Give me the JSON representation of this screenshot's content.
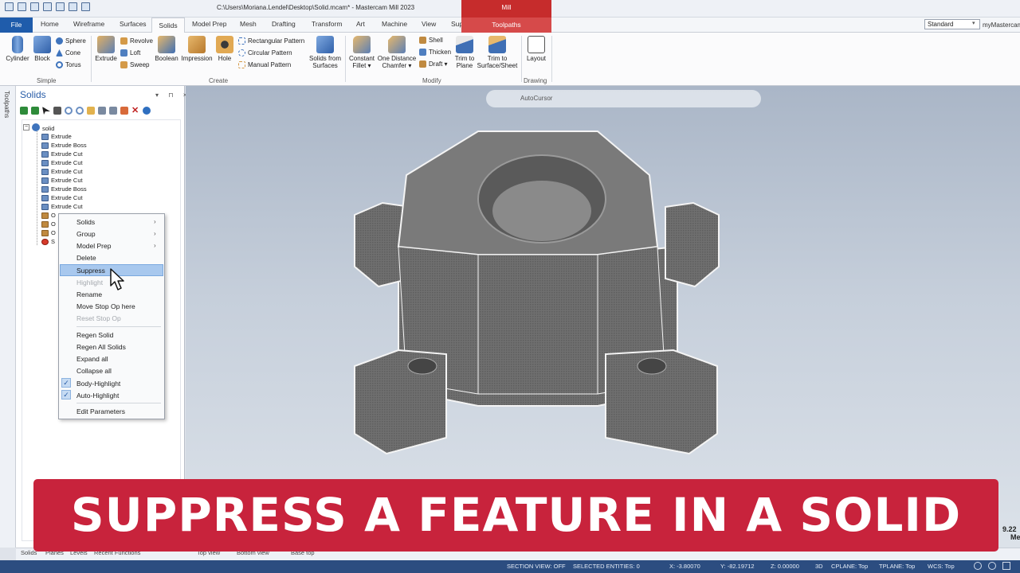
{
  "window": {
    "title": "C:\\Users\\Moriana.Lendel\\Desktop\\Solid.mcam* - Mastercam Mill 2023",
    "context_tab_group": "Mill"
  },
  "tabs": [
    "File",
    "Home",
    "Wireframe",
    "Surfaces",
    "Solids",
    "Model Prep",
    "Mesh",
    "Drafting",
    "Transform",
    "Art",
    "Machine",
    "View",
    "Support",
    "Toolpaths"
  ],
  "active_tab": "Solids",
  "view_select": "Standard",
  "my_mastercam": "myMastercam",
  "ribbon": {
    "groups": [
      "Simple",
      "Create",
      "Modify",
      "Drawing"
    ],
    "simple": {
      "cylinder": "Cylinder",
      "block": "Block",
      "sphere": "Sphere",
      "cone": "Cone",
      "torus": "Torus"
    },
    "create": {
      "extrude": "Extrude",
      "revolve": "Revolve",
      "loft": "Loft",
      "sweep": "Sweep",
      "boolean": "Boolean",
      "impression": "Impression",
      "hole": "Hole",
      "rect_pattern": "Rectangular Pattern",
      "circ_pattern": "Circular Pattern",
      "manual_pattern": "Manual Pattern",
      "solids_from_1": "Solids from",
      "solids_from_2": "Surfaces"
    },
    "modify": {
      "const_fillet_1": "Constant",
      "const_fillet_2": "Fillet ▾",
      "one_dist_1": "One Distance",
      "one_dist_2": "Chamfer ▾",
      "shell": "Shell",
      "thicken": "Thicken",
      "draft": "Draft ▾",
      "trim_plane_1": "Trim to",
      "trim_plane_2": "Plane",
      "trim_surf_1": "Trim to",
      "trim_surf_2": "Surface/Sheet"
    },
    "drawing": {
      "layout": "Layout"
    }
  },
  "dock_label": "Toolpaths",
  "panel": {
    "title": "Solids",
    "controls": "▾ ⊓ ×",
    "root": "solid",
    "items": [
      "Extrude",
      "Extrude Boss",
      "Extrude Cut",
      "Extrude Cut",
      "Extrude Cut",
      "Extrude Cut",
      "Extrude Boss",
      "Extrude Cut",
      "Extrude Cut"
    ],
    "partial_items": [
      "O",
      "O",
      "O",
      "S"
    ]
  },
  "context_menu": {
    "items": [
      {
        "label": "Solids",
        "submenu": true,
        "disabled": false
      },
      {
        "label": "Group",
        "submenu": true,
        "disabled": false
      },
      {
        "label": "Model Prep",
        "submenu": true,
        "disabled": false
      },
      {
        "label": "Delete",
        "disabled": false
      },
      {
        "label": "Suppress",
        "disabled": false,
        "highlighted": true
      },
      {
        "label": "Highlight",
        "disabled": true
      },
      {
        "label": "Rename",
        "disabled": false
      },
      {
        "label": "Move Stop Op here",
        "disabled": false
      },
      {
        "label": "Reset Stop Op",
        "disabled": true
      },
      {
        "label": "Regen Solid",
        "disabled": false
      },
      {
        "label": "Regen All Solids",
        "disabled": false
      },
      {
        "label": "Expand all",
        "disabled": false
      },
      {
        "label": "Collapse all",
        "disabled": false
      },
      {
        "label": "Body-Highlight",
        "checked": true
      },
      {
        "label": "Auto-Highlight",
        "checked": true
      },
      {
        "label": "Edit Parameters",
        "disabled": false
      }
    ]
  },
  "autocursor": "AutoCursor",
  "banner": "SUPPRESS A FEATURE IN A SOLID",
  "bottom_tabs": [
    "Solids",
    "Planes",
    "Levels",
    "Recent Functions",
    "Top view",
    "Bottom view",
    "Base top"
  ],
  "status": {
    "section_view": "SECTION VIEW: OFF",
    "selected": "SELECTED ENTITIES: 0",
    "x": "X: -3.80070",
    "y": "Y: -82.19712",
    "z": "Z: 0.00000",
    "mode": "3D",
    "cplane": "CPLANE: Top",
    "tplane": "TPLANE: Top",
    "wcs": "WCS: Top"
  },
  "side_num": "9.22",
  "side_num2": "Me"
}
